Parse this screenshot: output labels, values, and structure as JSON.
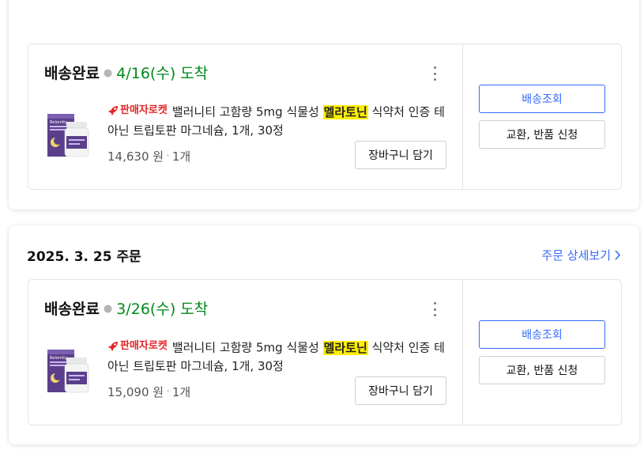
{
  "orders": [
    {
      "shipment": {
        "status": "배송완료",
        "arrival": "4/16(수) 도착",
        "product": {
          "badge": "판매자로켓",
          "name_before": "밸러니티 고함량 5mg 식물성 ",
          "name_highlight": "멜라토닌",
          "name_after": " 식약처 인증 테아닌 트립토판 마그네슘, 1개, 30정",
          "price": "14,630 원",
          "qty": "1개",
          "image_label": "Belomity"
        },
        "cart_button": "장바구니 담기",
        "track_button": "배송조회",
        "return_button": "교환, 반품 신청"
      }
    },
    {
      "date": "2025. 3. 25 주문",
      "detail_link": "주문 상세보기",
      "shipment": {
        "status": "배송완료",
        "arrival": "3/26(수) 도착",
        "product": {
          "badge": "판매자로켓",
          "name_before": "밸러니티 고함량 5mg 식물성 ",
          "name_highlight": "멜라토닌",
          "name_after": " 식약처 인증 테아닌 트립토판 마그네슘, 1개, 30정",
          "price": "15,090 원",
          "qty": "1개",
          "image_label": "Belomity"
        },
        "cart_button": "장바구니 담기",
        "track_button": "배송조회",
        "return_button": "교환, 반품 신청"
      }
    }
  ],
  "colors": {
    "accent_blue": "#346aff",
    "arrival_green": "#00891a",
    "rocket_red": "#e52528",
    "highlight_yellow": "#ffee00"
  },
  "icons": [
    "rocket-icon",
    "kebab-menu-icon",
    "chevron-right-icon",
    "product-bottle-image"
  ]
}
